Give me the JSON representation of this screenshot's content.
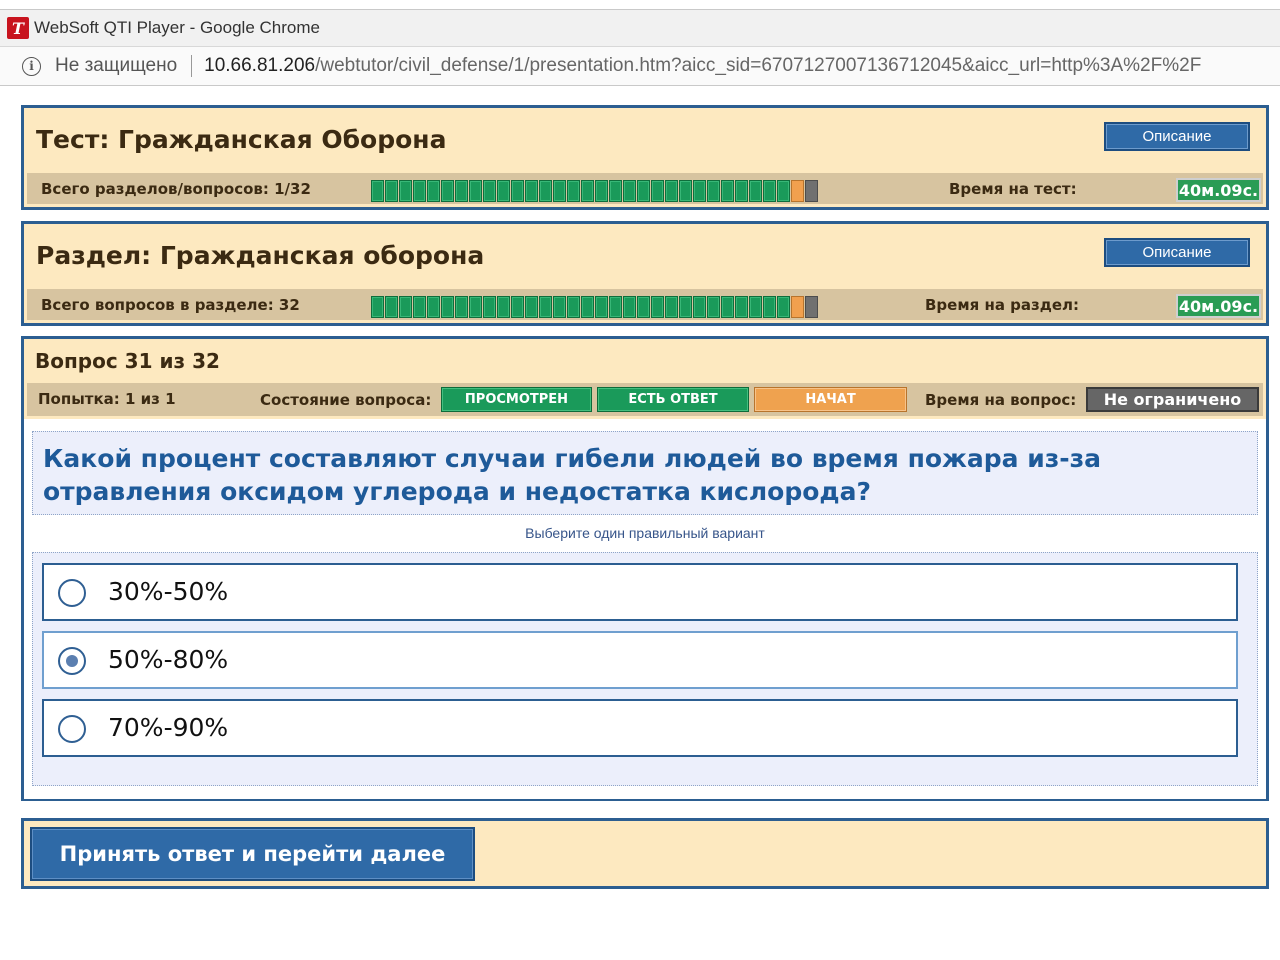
{
  "browser": {
    "window_title": "WebSoft QTI Player - Google Chrome",
    "insecure_label": "Не защищено",
    "url_host": "10.66.81.206",
    "url_path": "/webtutor/civil_defense/1/presentation.htm?aicc_sid=6707127007136712045&aicc_url=http%3A%2F%2F"
  },
  "test": {
    "title": "Тест: Гражданская Оборона",
    "description_button": "Описание",
    "count_label": "Всего разделов/вопросов: 1/32",
    "time_label": "Время на тест:",
    "timer": "40м.09с.",
    "progress": {
      "total": 32,
      "done": 30,
      "current": 31
    }
  },
  "section": {
    "title": "Раздел: Гражданская оборона",
    "description_button": "Описание",
    "count_label": "Всего вопросов в разделе: 32",
    "time_label": "Время на раздел:",
    "timer": "40м.09с.",
    "progress": {
      "total": 32,
      "done": 30,
      "current": 31
    }
  },
  "question": {
    "heading": "Вопрос 31 из 32",
    "attempt": "Попытка: 1 из 1",
    "state_label": "Состояние вопроса:",
    "states": [
      "ПРОСМОТРЕН",
      "ЕСТЬ ОТВЕТ",
      "НАЧАТ"
    ],
    "time_label": "Время на вопрос:",
    "time_value": "Не ограничено",
    "text": "Какой процент составляют случаи гибели людей во время пожара из-за отравления оксидом углерода и недостатка кислорода?",
    "hint": "Выберите один правильный вариант",
    "options": [
      {
        "label": "30%-50%",
        "selected": false
      },
      {
        "label": "50%-80%",
        "selected": true
      },
      {
        "label": "70%-90%",
        "selected": false
      }
    ]
  },
  "submit_button": "Принять ответ и перейти далее",
  "colors": {
    "panel_bg": "#fde9c0",
    "panel_border": "#2c5e91",
    "progress_done": "#1a9a5a",
    "progress_current": "#f1a04e",
    "progress_rest": "#707070",
    "button_blue": "#2f6aa7",
    "question_text": "#1e5a99"
  }
}
